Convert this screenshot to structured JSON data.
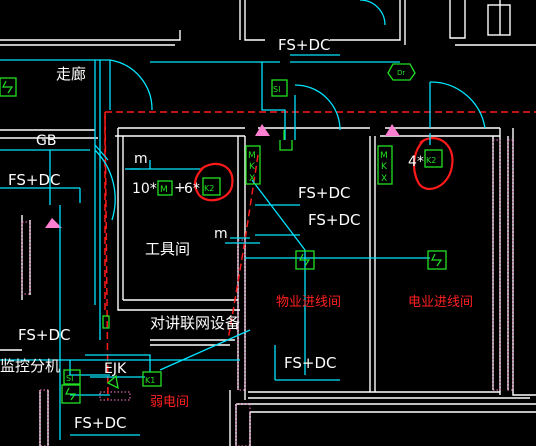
{
  "drawing": {
    "background": "#000000",
    "colors": {
      "wall": "#ffffff",
      "wire": "#00e5ff",
      "device": "#22e022",
      "room_label": "#ff2020",
      "annotation_circle": "#ff1a1a",
      "hatch": "#ff7fd0",
      "text": "#ffffff"
    },
    "labels": {
      "corridor": "走廊",
      "gb": "GB",
      "fsdc_top": "FS+DC",
      "fsdc_left": "FS+DC",
      "fsdc_mid1": "FS+DC",
      "fsdc_mid2": "FS+DC",
      "fsdc_bottom_left": "FS+DC",
      "fsdc_bottom_mid": "FS+DC",
      "fsdc_bottom_lower": "FS+DC",
      "m_upper": "m",
      "m_lower": "m",
      "tool_room": "工具间",
      "intercom_equipment": "对讲联网设备",
      "property_shaft": "物业进线间",
      "power_shaft": "电业进线间",
      "weak_room": "弱电间",
      "monitor_box": "监控分机",
      "ejk": "EJK",
      "qty_10": "10*",
      "qty_6": "6*",
      "qty_4": "4*",
      "plus": "+"
    },
    "symbols": {
      "m_box": "M",
      "k2": "K2",
      "k1": "K1",
      "si": "SI",
      "mkx": "MKX",
      "dt": "Dr"
    }
  }
}
